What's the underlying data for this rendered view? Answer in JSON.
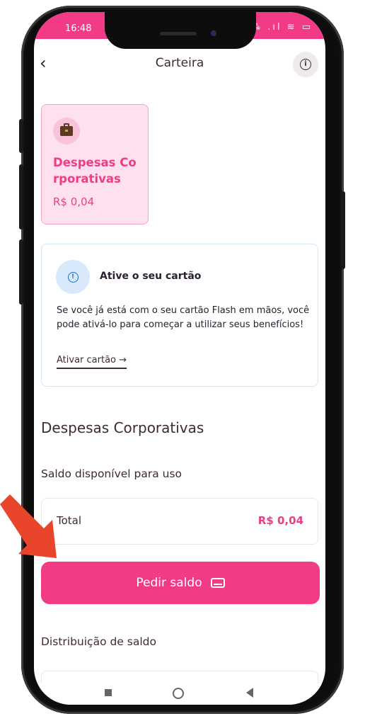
{
  "status_bar": {
    "time": "16:48",
    "icons": "⁂ .ıl ≋ ▭"
  },
  "header": {
    "title": "Carteira",
    "back_icon": "chevron-left-icon",
    "info_icon": "info-icon"
  },
  "wallet_card": {
    "name": "Despesas Corporativas",
    "balance": "R$ 0,04",
    "icon": "briefcase-icon"
  },
  "activate_card": {
    "title": "Ative o seu cartão",
    "text": "Se você já está com o seu cartão Flash em mãos, você pode ativá-lo para começar a utilizar seus benefícios!",
    "link": "Ativar cartão →"
  },
  "section": {
    "title": "Despesas Corporativas",
    "subtitle": "Saldo disponível para uso",
    "total_label": "Total",
    "total_value": "R$ 0,04"
  },
  "cta": {
    "label": "Pedir saldo"
  },
  "distribution": {
    "title": "Distribuição de saldo"
  },
  "colors": {
    "brand_pink": "#f23b86",
    "card_pink_bg": "#ffe0ee",
    "info_blue": "#1e6fc2",
    "arrow_red": "#e8452c"
  }
}
